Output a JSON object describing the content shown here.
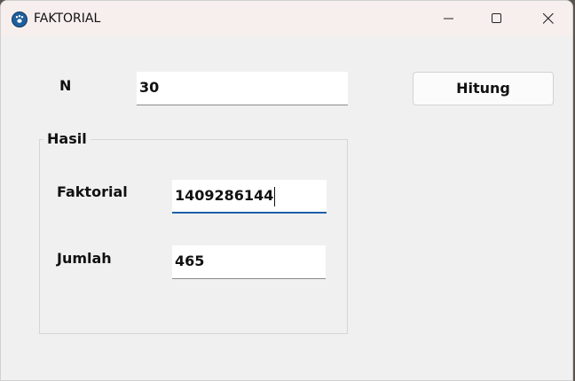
{
  "window": {
    "title": "FAKTORIAL",
    "app_icon": "paw-icon",
    "controls": {
      "minimize_icon": "minimize-icon",
      "maximize_icon": "maximize-icon",
      "close_icon": "close-icon"
    }
  },
  "form": {
    "n_label": "N",
    "n_value": "30",
    "calc_button_label": "Hitung"
  },
  "result_group": {
    "title": "Hasil",
    "factorial_label": "Faktorial",
    "factorial_value": "1409286144",
    "sum_label": "Jumlah",
    "sum_value": "465"
  },
  "colors": {
    "titlebar": "#f7efed",
    "window_bg": "#f0f0f0",
    "focus_accent": "#1e5fa6"
  }
}
